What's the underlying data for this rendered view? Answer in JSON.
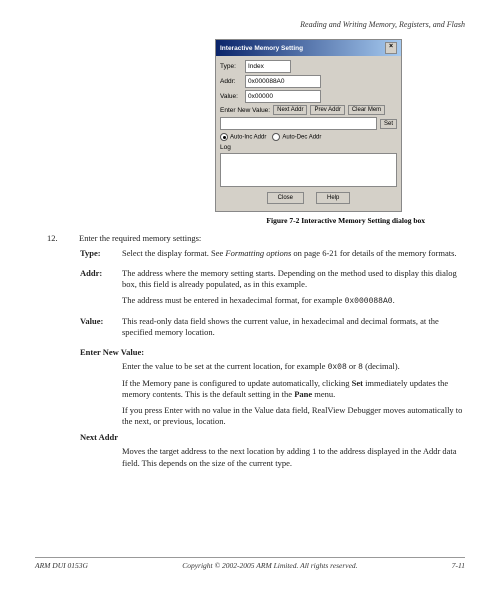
{
  "running_header": "Reading and Writing Memory, Registers, and Flash",
  "dialog": {
    "title": "Interactive Memory Setting",
    "type_label": "Type:",
    "type_value": "Index",
    "addr_label": "Addr:",
    "addr_value": "0x000088A0",
    "value_label": "Value:",
    "value_value": "0x00000",
    "enter_label": "Enter New Value:",
    "next_addr_btn": "Next Addr",
    "prev_addr_btn": "Prev Addr",
    "clear_mem_btn": "Clear Mem",
    "set_btn": "Set",
    "auto_inc": "Auto-Inc Addr",
    "auto_dec": "Auto-Dec Addr",
    "log_label": "Log",
    "close_btn": "Close",
    "help_btn": "Help"
  },
  "figure_caption": "Figure 7-2 Interactive Memory Setting dialog box",
  "step": {
    "num": "12.",
    "intro": "Enter the required memory settings:"
  },
  "fields": {
    "type": {
      "label": "Type:",
      "text1": "Select the display format. See ",
      "text1_ital": "Formatting options",
      "text1_tail": " on page 6-21 for details of the memory formats."
    },
    "addr": {
      "label": "Addr:",
      "text1": "The address where the memory setting starts. Depending on the method used to display this dialog box, this field is already populated, as in this example.",
      "text2": "The address must be entered in hexadecimal format, for example ",
      "text2_mono": "0x000088A0",
      "text2_tail": "."
    },
    "value": {
      "label": "Value:",
      "text1": "This read-only data field shows the current value, in hexadecimal and decimal formats, at the specified memory location."
    }
  },
  "enter_new": {
    "heading": "Enter New Value:",
    "p1a": "Enter the value to be set at the current location, for example ",
    "p1_mono1": "0x08",
    "p1b": " or ",
    "p1_mono2": "8",
    "p1c": " (decimal).",
    "p2a": "If the Memory pane is configured to update automatically, clicking ",
    "p2_bold": "Set",
    "p2b": " immediately updates the memory contents. This is the default setting in the ",
    "p2_bold2": "Pane",
    "p2c": " menu.",
    "p3": "If you press Enter with no value in the Value data field, RealView Debugger moves automatically to the next, or previous, location."
  },
  "next_addr": {
    "heading": "Next Addr",
    "p1": "Moves the target address to the next location by adding 1 to the address displayed in the Addr data field. This depends on the size of the current type."
  },
  "footer": {
    "left": "ARM DUI 0153G",
    "center": "Copyright © 2002-2005 ARM Limited. All rights reserved.",
    "right": "7-11"
  }
}
